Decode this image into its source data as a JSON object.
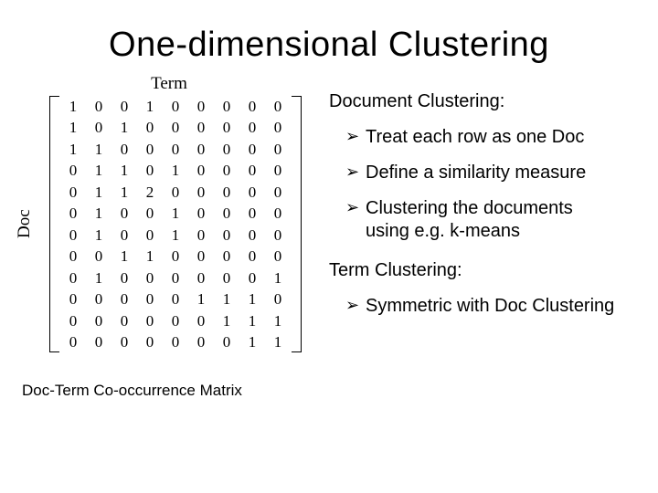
{
  "title": "One-dimensional Clustering",
  "matrix": {
    "col_label": "Term",
    "row_label": "Doc",
    "rows": [
      [
        1,
        0,
        0,
        1,
        0,
        0,
        0,
        0,
        0
      ],
      [
        1,
        0,
        1,
        0,
        0,
        0,
        0,
        0,
        0
      ],
      [
        1,
        1,
        0,
        0,
        0,
        0,
        0,
        0,
        0
      ],
      [
        0,
        1,
        1,
        0,
        1,
        0,
        0,
        0,
        0
      ],
      [
        0,
        1,
        1,
        2,
        0,
        0,
        0,
        0,
        0
      ],
      [
        0,
        1,
        0,
        0,
        1,
        0,
        0,
        0,
        0
      ],
      [
        0,
        1,
        0,
        0,
        1,
        0,
        0,
        0,
        0
      ],
      [
        0,
        0,
        1,
        1,
        0,
        0,
        0,
        0,
        0
      ],
      [
        0,
        1,
        0,
        0,
        0,
        0,
        0,
        0,
        1
      ],
      [
        0,
        0,
        0,
        0,
        0,
        1,
        1,
        1,
        0
      ],
      [
        0,
        0,
        0,
        0,
        0,
        0,
        1,
        1,
        1
      ],
      [
        0,
        0,
        0,
        0,
        0,
        0,
        0,
        1,
        1
      ]
    ],
    "caption": "Doc-Term Co-occurrence Matrix"
  },
  "sections": [
    {
      "heading": "Document Clustering:",
      "bullets": [
        "Treat each row as one Doc",
        "Define a similarity measure",
        "Clustering the documents using e.g. k-means"
      ]
    },
    {
      "heading": "Term Clustering:",
      "bullets": [
        "Symmetric with Doc Clustering"
      ]
    }
  ]
}
